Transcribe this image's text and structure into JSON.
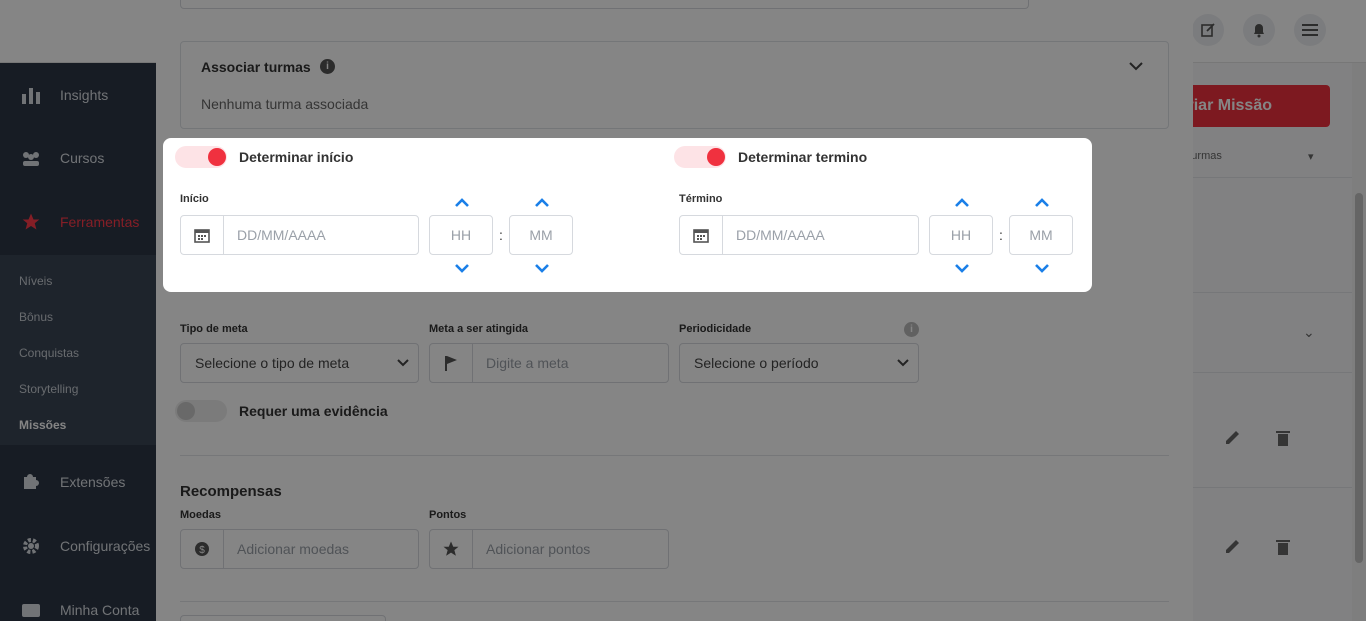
{
  "sidebar": {
    "items": [
      {
        "label": "Insights",
        "icon": "bar-chart-icon"
      },
      {
        "label": "Cursos",
        "icon": "users-icon"
      },
      {
        "label": "Ferramentas",
        "icon": "star-icon"
      },
      {
        "label": "Extensões",
        "icon": "puzzle-icon"
      },
      {
        "label": "Configurações",
        "icon": "gear-icon"
      },
      {
        "label": "Minha Conta",
        "icon": "wallet-icon"
      }
    ],
    "submenu": [
      "Níveis",
      "Bônus",
      "Conquistas",
      "Storytelling",
      "Missões"
    ]
  },
  "right": {
    "create_button": "Criar Missão",
    "filter_text": "Turmas"
  },
  "modal": {
    "associate": {
      "title": "Associar turmas",
      "empty": "Nenhuma turma associada"
    },
    "start": {
      "toggle_label": "Determinar início",
      "field_label": "Início",
      "date_placeholder": "DD/MM/AAAA",
      "hour_placeholder": "HH",
      "minute_placeholder": "MM",
      "separator": ":"
    },
    "end": {
      "toggle_label": "Determinar termino",
      "field_label": "Término",
      "date_placeholder": "DD/MM/AAAA",
      "hour_placeholder": "HH",
      "minute_placeholder": "MM",
      "separator": ":"
    },
    "goal_type": {
      "label": "Tipo de meta",
      "value": "Selecione o tipo de meta"
    },
    "goal_target": {
      "label": "Meta a ser atingida",
      "placeholder": "Digite a meta"
    },
    "periodicity": {
      "label": "Periodicidade",
      "value": "Selecione o período"
    },
    "evidence": {
      "label": "Requer uma evidência"
    },
    "rewards": {
      "title": "Recompensas",
      "coins": {
        "label": "Moedas",
        "placeholder": "Adicionar moedas"
      },
      "points": {
        "label": "Pontos",
        "placeholder": "Adicionar pontos"
      }
    }
  },
  "colors": {
    "accent": "#f0313f",
    "chevron": "#1a7fe8",
    "sidebar": "#2d3745"
  }
}
